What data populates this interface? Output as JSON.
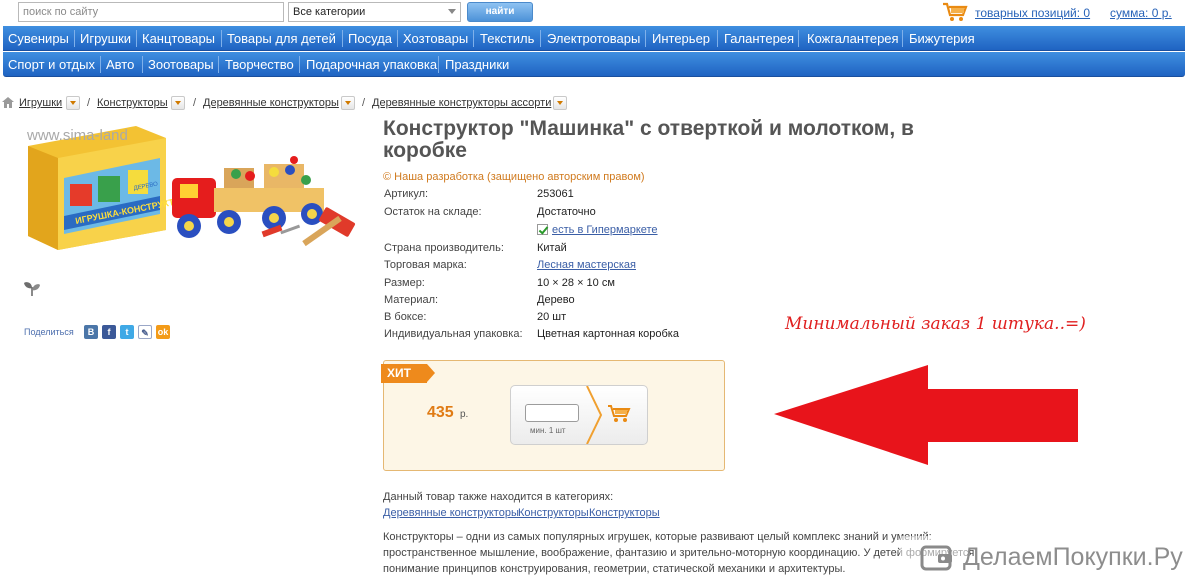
{
  "search": {
    "placeholder": "поиск по сайту",
    "category": "Все категории",
    "button": "найти"
  },
  "cart": {
    "items": "товарных позиций: 0",
    "sum": "сумма: 0 р."
  },
  "nav": {
    "row1": [
      "Сувениры",
      "Игрушки",
      "Канцтовары",
      "Товары для детей",
      "Посуда",
      "Хозтовары",
      "Текстиль",
      "Электротовары",
      "Интерьер",
      "Галантерея",
      "Кожгалантерея",
      "Бижутерия"
    ],
    "row2": [
      "Спорт и отдых",
      "Авто",
      "Зоотовары",
      "Творчество",
      "Подарочная упаковка",
      "Праздники"
    ]
  },
  "breadcrumb": [
    "Игрушки",
    "Конструкторы",
    "Деревянные конструкторы",
    "Деревянные конструкторы ассорти"
  ],
  "image": {
    "watermark": "www.sima-land",
    "box_text": "ИГРУШКА-КОНСТРУКТОР",
    "box_sub": "ДЕРЕВО"
  },
  "share": {
    "label": "Поделиться",
    "icons": [
      "vkontakte-icon",
      "facebook-icon",
      "twitter-icon",
      "livejournal-icon",
      "odnoklassniki-icon"
    ]
  },
  "product": {
    "title": "Конструктор \"Машинка\" с отверткой и молотком, в коробке",
    "copyright": "© Наша разработка (защищено авторским правом)",
    "specs": [
      {
        "label": "Артикул:",
        "value": "253061"
      },
      {
        "label": "Остаток на складе:",
        "value": "Достаточно"
      },
      {
        "label": "",
        "value": "есть в Гипермаркете",
        "link": true
      },
      {
        "label": "Страна производитель:",
        "value": "Китай"
      },
      {
        "label": "Торговая марка:",
        "value": "Лесная мастерская",
        "link": true
      },
      {
        "label": "Размер:",
        "value": "10 × 28 × 10 см"
      },
      {
        "label": "Материал:",
        "value": "Дерево"
      },
      {
        "label": "В боксе:",
        "value": "20 шт"
      },
      {
        "label": "Индивидуальная упаковка:",
        "value": "Цветная картонная коробка"
      }
    ]
  },
  "buy": {
    "badge": "ХИТ",
    "price": "435",
    "unit": "р.",
    "min_label": "мин. 1 шт",
    "qty_value": ""
  },
  "annotation": {
    "note": "Минимальный заказ 1 штука..=)"
  },
  "categories": {
    "title": "Данный товар также находится в категориях:",
    "links": [
      "Деревянные конструкторы",
      "Конструкторы",
      "Конструкторы"
    ]
  },
  "description": [
    "Конструкторы – одни из самых популярных игрушек, которые развивают целый комплекс знаний и умений:",
    "пространственное мышление, воображение, фантазию и зрительно-моторную координацию. У детей формируется",
    "понимание принципов конструирования, геометрии, статической механики и архитектуры."
  ],
  "site": {
    "name": "ДелаемПокупки.Ру"
  },
  "colors": {
    "nav": "#2f7ad6",
    "price": "#e07b14",
    "badge": "#ee8a1c",
    "arrow": "#e8141b",
    "note": "#e02020"
  }
}
